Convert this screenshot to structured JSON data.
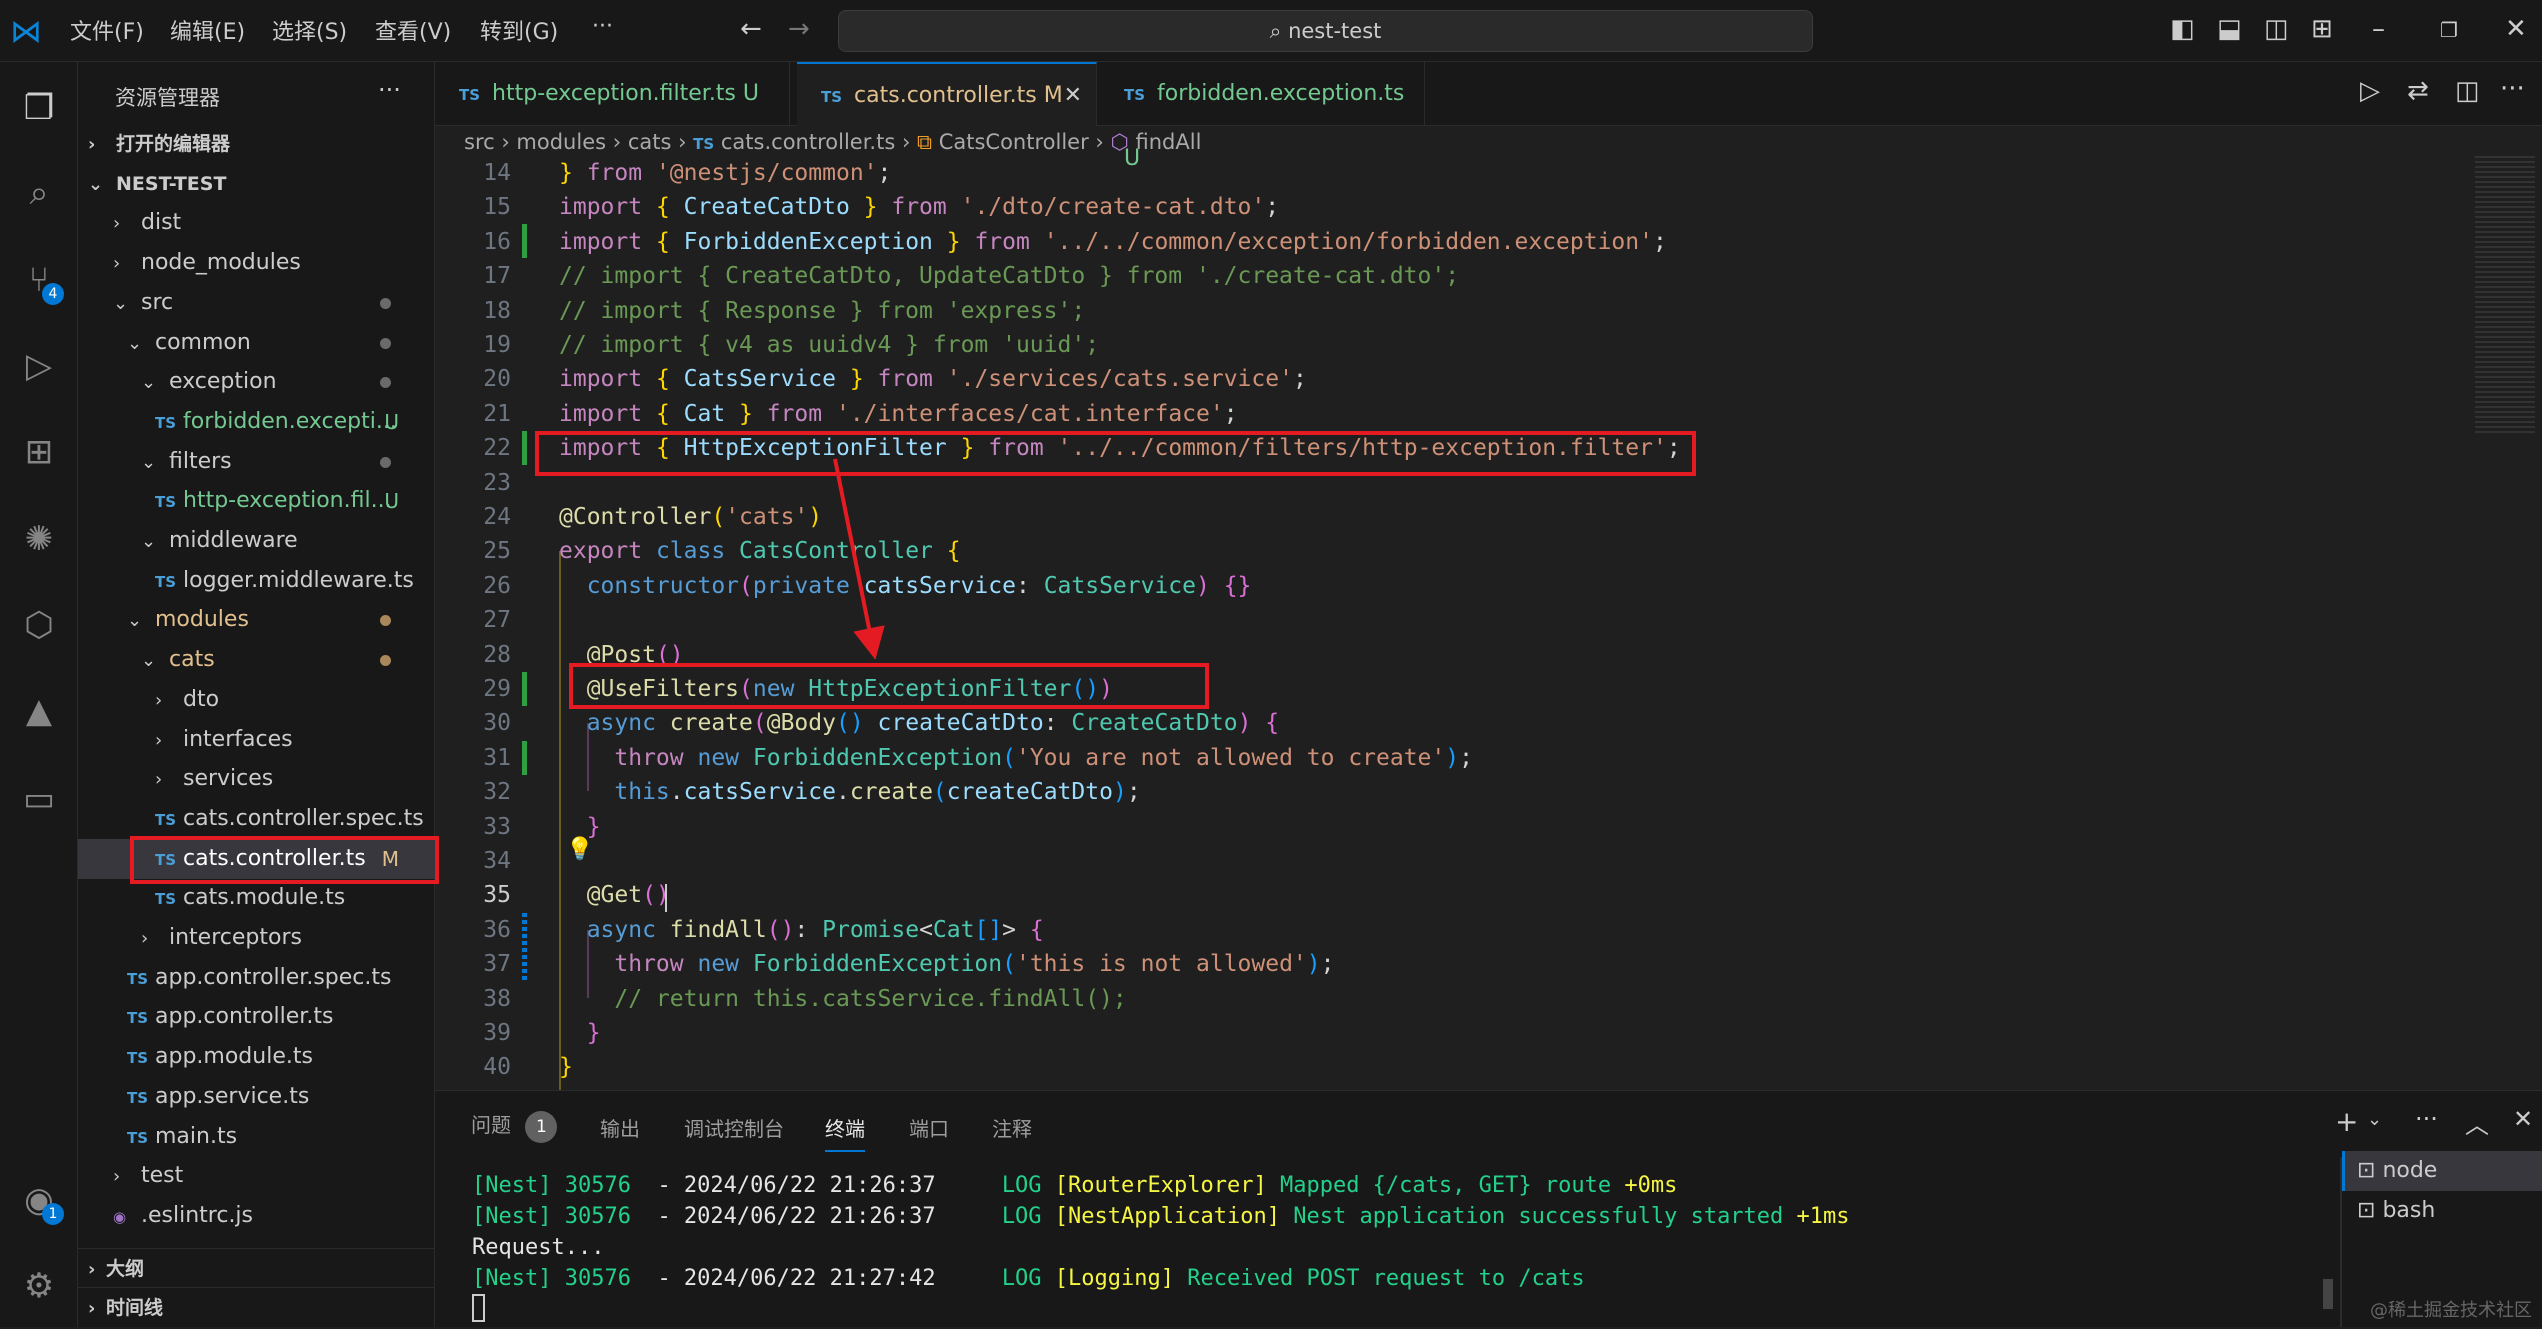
{
  "titlebar": {
    "menus": [
      "文件(F)",
      "编辑(E)",
      "选择(S)",
      "查看(V)",
      "转到(G)",
      "···"
    ],
    "search": "nest-test"
  },
  "activity": {
    "scm_badge": "4",
    "account_badge": "1"
  },
  "sidebar": {
    "title": "资源管理器",
    "more": "···",
    "items": [
      {
        "label": "打开的编辑器",
        "type": "section",
        "chev": ">"
      },
      {
        "label": "NEST-TEST",
        "type": "section",
        "chev": "v"
      },
      {
        "label": "dist",
        "level": 1,
        "chev": ">"
      },
      {
        "label": "node_modules",
        "level": 1,
        "chev": ">"
      },
      {
        "label": "src",
        "level": 1,
        "chev": "v",
        "dot": true
      },
      {
        "label": "common",
        "level": 2,
        "chev": "v",
        "dot": true
      },
      {
        "label": "exception",
        "level": 3,
        "chev": "v",
        "dot": true
      },
      {
        "label": "forbidden.excepti...",
        "level": 4,
        "file": "TS",
        "status": "U",
        "statusColor": "#73c991",
        "color": "#73c991"
      },
      {
        "label": "filters",
        "level": 3,
        "chev": "v",
        "dot": true
      },
      {
        "label": "http-exception.fil...",
        "level": 4,
        "file": "TS",
        "status": "U",
        "statusColor": "#73c991",
        "color": "#73c991"
      },
      {
        "label": "middleware",
        "level": 3,
        "chev": "v"
      },
      {
        "label": "logger.middleware.ts",
        "level": 4,
        "file": "TS"
      },
      {
        "label": "modules",
        "level": 2,
        "chev": "v",
        "dot": true,
        "color": "#e2c08d"
      },
      {
        "label": "cats",
        "level": 3,
        "chev": "v",
        "dot": true,
        "color": "#e2c08d"
      },
      {
        "label": "dto",
        "level": 4,
        "chev": ">"
      },
      {
        "label": "interfaces",
        "level": 4,
        "chev": ">"
      },
      {
        "label": "services",
        "level": 4,
        "chev": ">"
      },
      {
        "label": "cats.controller.spec.ts",
        "level": 4,
        "file": "TS"
      },
      {
        "label": "cats.controller.ts",
        "level": 4,
        "file": "TS",
        "status": "M",
        "statusColor": "#e2c08d",
        "selected": true
      },
      {
        "label": "cats.module.ts",
        "level": 4,
        "file": "TS"
      },
      {
        "label": "interceptors",
        "level": 3,
        "chev": ">"
      },
      {
        "label": "app.controller.spec.ts",
        "level": 2,
        "file": "TS"
      },
      {
        "label": "app.controller.ts",
        "level": 2,
        "file": "TS"
      },
      {
        "label": "app.module.ts",
        "level": 2,
        "file": "TS"
      },
      {
        "label": "app.service.ts",
        "level": 2,
        "file": "TS"
      },
      {
        "label": "main.ts",
        "level": 2,
        "file": "TS"
      },
      {
        "label": "test",
        "level": 1,
        "chev": ">"
      },
      {
        "label": ".eslintrc.js",
        "level": 1,
        "file": "◉"
      }
    ],
    "bottom": [
      {
        "label": "大纲"
      },
      {
        "label": "时间线"
      }
    ]
  },
  "tabs": [
    {
      "label": "http-exception.filter.ts",
      "status": "U",
      "active": false
    },
    {
      "label": "cats.controller.ts",
      "status": "M",
      "active": true
    },
    {
      "label": "forbidden.exception.ts",
      "status": "U",
      "active": false
    }
  ],
  "breadcrumb": [
    "src",
    "modules",
    "cats",
    "cats.controller.ts",
    "CatsController",
    "findAll"
  ],
  "code": {
    "start": 14,
    "current": 35,
    "lines": [
      [
        [
          "}",
          "y"
        ],
        [
          " from ",
          "k"
        ],
        [
          "'@nestjs/common'",
          "s"
        ],
        [
          ";",
          "w"
        ]
      ],
      [
        [
          "import ",
          "k"
        ],
        [
          "{ ",
          "y"
        ],
        [
          "CreateCatDto",
          "v"
        ],
        [
          " }",
          "y"
        ],
        [
          " from ",
          "k"
        ],
        [
          "'./dto/create-cat.dto'",
          "s"
        ],
        [
          ";",
          "w"
        ]
      ],
      [
        [
          "import ",
          "k"
        ],
        [
          "{ ",
          "y"
        ],
        [
          "ForbiddenException",
          "v"
        ],
        [
          " }",
          "y"
        ],
        [
          " from ",
          "k"
        ],
        [
          "'../../common/exception/forbidden.exception'",
          "s"
        ],
        [
          ";",
          "w"
        ]
      ],
      [
        [
          "// import { CreateCatDto, UpdateCatDto } from './create-cat.dto';",
          "c"
        ]
      ],
      [
        [
          "// import { Response } from 'express';",
          "c"
        ]
      ],
      [
        [
          "// import { v4 as uuidv4 } from 'uuid';",
          "c"
        ]
      ],
      [
        [
          "import ",
          "k"
        ],
        [
          "{ ",
          "y"
        ],
        [
          "CatsService",
          "v"
        ],
        [
          " }",
          "y"
        ],
        [
          " from ",
          "k"
        ],
        [
          "'./services/cats.service'",
          "s"
        ],
        [
          ";",
          "w"
        ]
      ],
      [
        [
          "import ",
          "k"
        ],
        [
          "{ ",
          "y"
        ],
        [
          "Cat",
          "v"
        ],
        [
          " }",
          "y"
        ],
        [
          " from ",
          "k"
        ],
        [
          "'./interfaces/cat.interface'",
          "s"
        ],
        [
          ";",
          "w"
        ]
      ],
      [
        [
          "import ",
          "k"
        ],
        [
          "{ ",
          "y"
        ],
        [
          "HttpExceptionFilter",
          "v"
        ],
        [
          " }",
          "y"
        ],
        [
          " from ",
          "k"
        ],
        [
          "'../../common/filters/http-exception.filter'",
          "s"
        ],
        [
          ";",
          "w"
        ]
      ],
      [],
      [
        [
          "@Controller",
          "f"
        ],
        [
          "(",
          "y"
        ],
        [
          "'cats'",
          "s"
        ],
        [
          ")",
          "y"
        ]
      ],
      [
        [
          "export ",
          "k"
        ],
        [
          "class ",
          "b"
        ],
        [
          "CatsController ",
          "t"
        ],
        [
          "{",
          "y"
        ]
      ],
      [
        [
          "  constructor",
          "b"
        ],
        [
          "(",
          "p"
        ],
        [
          "private ",
          "b"
        ],
        [
          "catsService",
          "v"
        ],
        [
          ": ",
          "w"
        ],
        [
          "CatsService",
          "t"
        ],
        [
          ") {}",
          "p"
        ]
      ],
      [],
      [
        [
          "  @Post",
          "f"
        ],
        [
          "()",
          "p"
        ]
      ],
      [
        [
          "  @UseFilters",
          "f"
        ],
        [
          "(",
          "p"
        ],
        [
          "new ",
          "b"
        ],
        [
          "HttpExceptionFilter",
          "t"
        ],
        [
          "()",
          "q"
        ],
        [
          ")",
          "p"
        ]
      ],
      [
        [
          "  async ",
          "b"
        ],
        [
          "create",
          "f"
        ],
        [
          "(",
          "p"
        ],
        [
          "@Body",
          "f"
        ],
        [
          "() ",
          "q"
        ],
        [
          "createCatDto",
          "v"
        ],
        [
          ": ",
          "w"
        ],
        [
          "CreateCatDto",
          "t"
        ],
        [
          ") {",
          "p"
        ]
      ],
      [
        [
          "    throw ",
          "k"
        ],
        [
          "new ",
          "b"
        ],
        [
          "ForbiddenException",
          "t"
        ],
        [
          "(",
          "q"
        ],
        [
          "'You are not allowed to create'",
          "s"
        ],
        [
          ")",
          "q"
        ],
        [
          ";",
          "w"
        ]
      ],
      [
        [
          "    this",
          "b"
        ],
        [
          ".",
          "w"
        ],
        [
          "catsService",
          "v"
        ],
        [
          ".",
          "w"
        ],
        [
          "create",
          "f"
        ],
        [
          "(",
          "q"
        ],
        [
          "createCatDto",
          "v"
        ],
        [
          ")",
          "q"
        ],
        [
          ";",
          "w"
        ]
      ],
      [
        [
          "  }",
          "p"
        ]
      ],
      [],
      [
        [
          "  @Get",
          "f"
        ],
        [
          "()",
          "p"
        ]
      ],
      [
        [
          "  async ",
          "b"
        ],
        [
          "findAll",
          "f"
        ],
        [
          "()",
          "p"
        ],
        [
          ": ",
          "w"
        ],
        [
          "Promise",
          "t"
        ],
        [
          "<",
          "w"
        ],
        [
          "Cat",
          "t"
        ],
        [
          "[]",
          "q"
        ],
        [
          "> ",
          "w"
        ],
        [
          "{",
          "p"
        ]
      ],
      [
        [
          "    throw ",
          "k"
        ],
        [
          "new ",
          "b"
        ],
        [
          "ForbiddenException",
          "t"
        ],
        [
          "(",
          "q"
        ],
        [
          "'this is not allowed'",
          "s"
        ],
        [
          ")",
          "q"
        ],
        [
          ";",
          "w"
        ]
      ],
      [
        [
          "    // return this.catsService.findAll();",
          "c"
        ]
      ],
      [
        [
          "  }",
          "p"
        ]
      ],
      [
        [
          "}",
          "y"
        ]
      ]
    ]
  },
  "panel": {
    "tabs": [
      "问题",
      "输出",
      "调试控制台",
      "终端",
      "端口",
      "注释"
    ],
    "problems_count": "1",
    "active": "终端",
    "terminals": [
      "node",
      "bash"
    ],
    "lines": [
      [
        [
          "[Nest] 30576  ",
          "g"
        ],
        [
          "- 2024/06/22 21:26:37     ",
          "wt"
        ],
        [
          "LOG ",
          "g"
        ],
        [
          "[RouterExplorer] ",
          "gy"
        ],
        [
          "Mapped {/cats, GET} route ",
          "g"
        ],
        [
          "+0ms",
          "gy"
        ]
      ],
      [
        [
          "[Nest] 30576  ",
          "g"
        ],
        [
          "- 2024/06/22 21:26:37     ",
          "wt"
        ],
        [
          "LOG ",
          "g"
        ],
        [
          "[NestApplication] ",
          "gy"
        ],
        [
          "Nest application successfully started ",
          "g"
        ],
        [
          "+1ms",
          "gy"
        ]
      ],
      [
        [
          "Request...",
          "wt"
        ]
      ],
      [
        [
          "[Nest] 30576  ",
          "g"
        ],
        [
          "- 2024/06/22 21:27:42     ",
          "wt"
        ],
        [
          "LOG ",
          "g"
        ],
        [
          "[Logging] ",
          "gy"
        ],
        [
          "Received POST request to /cats",
          "g"
        ]
      ]
    ]
  },
  "watermark": "@稀土掘金技术社区",
  "colors": {
    "accent": "#0078d4",
    "annotation": "#e51b23"
  }
}
